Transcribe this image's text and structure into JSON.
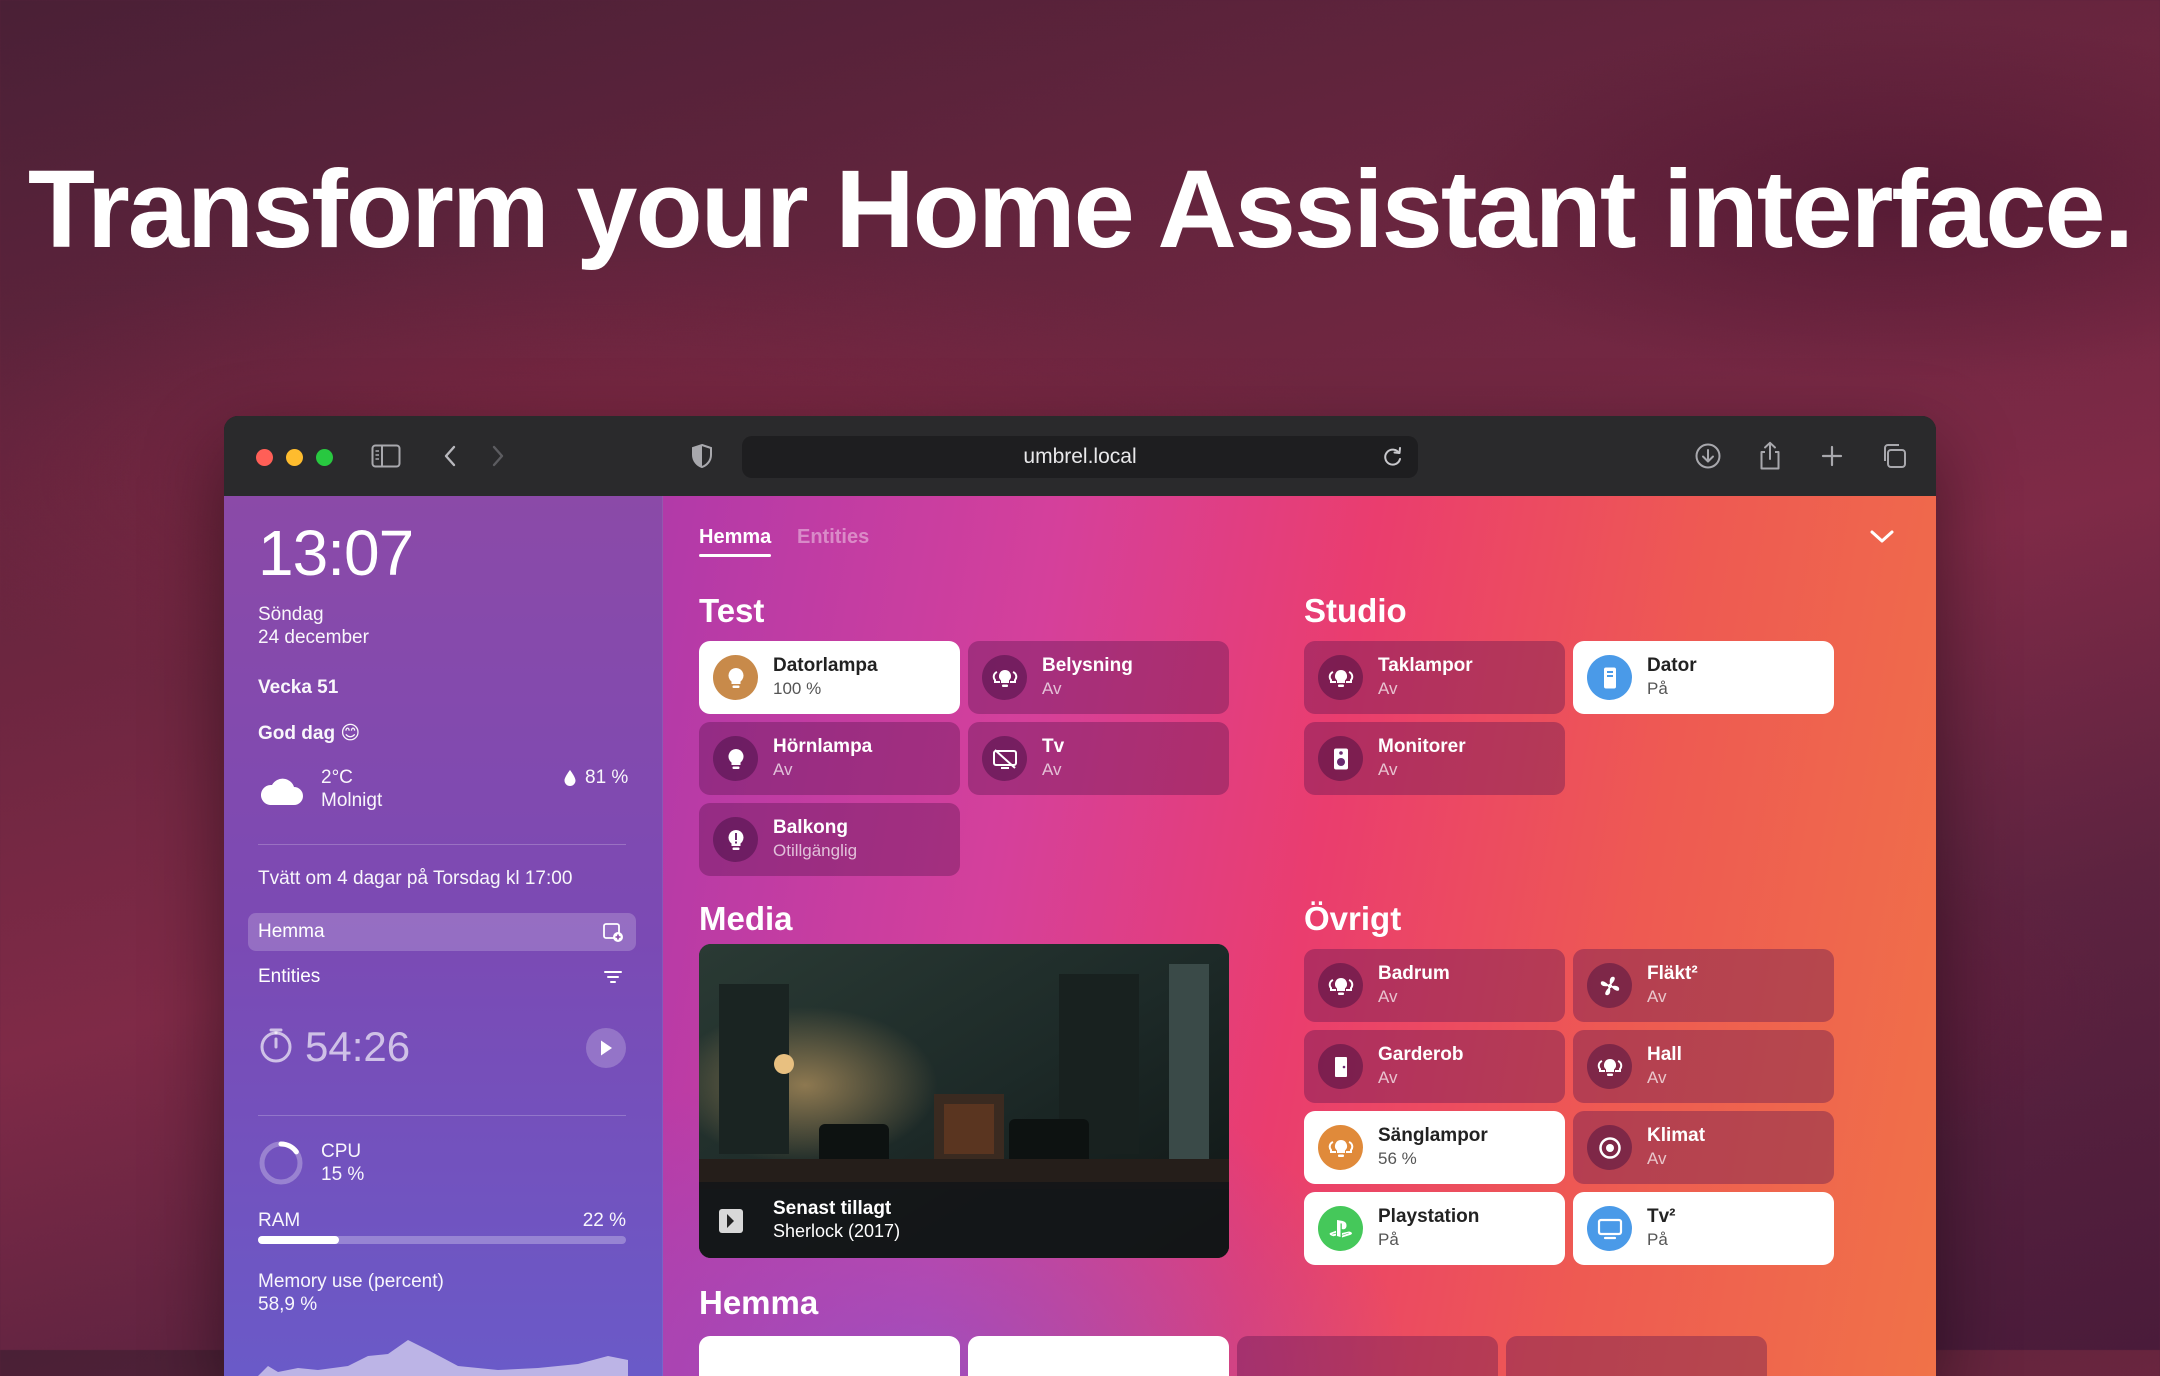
{
  "headline": "Transform your Home Assistant interface.",
  "browser": {
    "url": "umbrel.local",
    "traffic_lights": {
      "close": "#ff5f57",
      "minimize": "#febc2e",
      "zoom": "#28c840"
    }
  },
  "sidebar": {
    "time": "13:07",
    "day": "Söndag",
    "date": "24 december",
    "week": "Vecka 51",
    "greeting": "God dag 😊",
    "weather": {
      "temp": "2°C",
      "condition": "Molnigt",
      "humidity": "81 %",
      "icon": "cloud-icon"
    },
    "reminder": "Tvätt om 4 dagar på Torsdag kl 17:00",
    "nav": [
      {
        "label": "Hemma",
        "icon": "dashboard-edit-icon",
        "active": true
      },
      {
        "label": "Entities",
        "icon": "filter-icon",
        "active": false
      }
    ],
    "timer": "54:26",
    "cpu": {
      "label": "CPU",
      "value": "15 %",
      "fraction": 0.15
    },
    "ram": {
      "label": "RAM",
      "value": "22 %",
      "fraction": 0.22
    },
    "memory": {
      "label": "Memory use (percent)",
      "value": "58,9 %"
    }
  },
  "tabs": [
    {
      "label": "Hemma",
      "active": true
    },
    {
      "label": "Entities",
      "active": false
    }
  ],
  "sections": {
    "test": {
      "title": "Test",
      "tiles": [
        {
          "name": "Datorlampa",
          "state": "100 %",
          "on": true,
          "icon": "bulb-icon",
          "color": "#c88a4a"
        },
        {
          "name": "Belysning",
          "state": "Av",
          "on": false,
          "icon": "lights-group-icon"
        },
        {
          "name": "Hörnlampa",
          "state": "Av",
          "on": false,
          "icon": "bulb-icon"
        },
        {
          "name": "Tv",
          "state": "Av",
          "on": false,
          "icon": "tv-off-icon"
        },
        {
          "name": "Balkong",
          "state": "Otillgänglig",
          "on": false,
          "icon": "bulb-unavailable-icon"
        }
      ]
    },
    "studio": {
      "title": "Studio",
      "tiles": [
        {
          "name": "Taklampor",
          "state": "Av",
          "on": false,
          "icon": "lights-group-icon"
        },
        {
          "name": "Dator",
          "state": "På",
          "on": true,
          "icon": "computer-icon",
          "color": "#4a9ae8"
        },
        {
          "name": "Monitorer",
          "state": "Av",
          "on": false,
          "icon": "speaker-icon"
        }
      ]
    },
    "media": {
      "title": "Media",
      "footer_title": "Senast tillagt",
      "footer_subtitle": "Sherlock (2017)"
    },
    "ovrigt": {
      "title": "Övrigt",
      "tiles": [
        {
          "name": "Badrum",
          "state": "Av",
          "on": false,
          "icon": "lights-group-icon"
        },
        {
          "name": "Fläkt²",
          "state": "Av",
          "on": false,
          "icon": "fan-icon"
        },
        {
          "name": "Garderob",
          "state": "Av",
          "on": false,
          "icon": "door-icon"
        },
        {
          "name": "Hall",
          "state": "Av",
          "on": false,
          "icon": "lights-group-icon"
        },
        {
          "name": "Sänglampor",
          "state": "56 %",
          "on": true,
          "icon": "lights-group-icon",
          "color": "#e08a3a"
        },
        {
          "name": "Klimat",
          "state": "Av",
          "on": false,
          "icon": "thermostat-icon"
        },
        {
          "name": "Playstation",
          "state": "På",
          "on": true,
          "icon": "playstation-icon",
          "color": "#45c85a"
        },
        {
          "name": "Tv²",
          "state": "På",
          "on": true,
          "icon": "monitor-icon",
          "color": "#4a9ae8"
        }
      ]
    },
    "hemma": {
      "title": "Hemma"
    }
  }
}
